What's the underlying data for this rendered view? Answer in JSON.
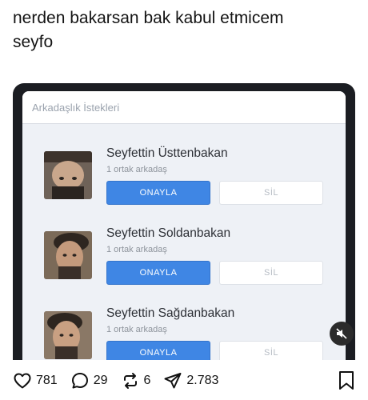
{
  "post": {
    "line1": "nerden bakarsan bak kabul etmicem",
    "line2": "seyfo"
  },
  "screen": {
    "title": "Arkadaşlık İstekleri",
    "requests": [
      {
        "name": "Seyfettin Üsttenbakan",
        "mutual": "1 ortak arkadaş",
        "confirm_label": "ONAYLA",
        "delete_label": "SİL"
      },
      {
        "name": "Seyfettin Soldanbakan",
        "mutual": "1 ortak arkadaş",
        "confirm_label": "ONAYLA",
        "delete_label": "SİL"
      },
      {
        "name": "Seyfettin Sağdanbakan",
        "mutual": "1 ortak arkadaş",
        "confirm_label": "ONAYLA",
        "delete_label": "SİL"
      }
    ]
  },
  "actions": {
    "likes": "781",
    "replies": "29",
    "reposts": "6",
    "shares": "2.783",
    "icons": [
      "heart-icon",
      "reply-icon",
      "repost-icon",
      "share-icon",
      "bookmark-icon",
      "mute-icon"
    ]
  },
  "colors": {
    "confirm": "#3f86e4",
    "phone_frame": "#1b1d22",
    "screen_bg": "#eef1f6"
  }
}
